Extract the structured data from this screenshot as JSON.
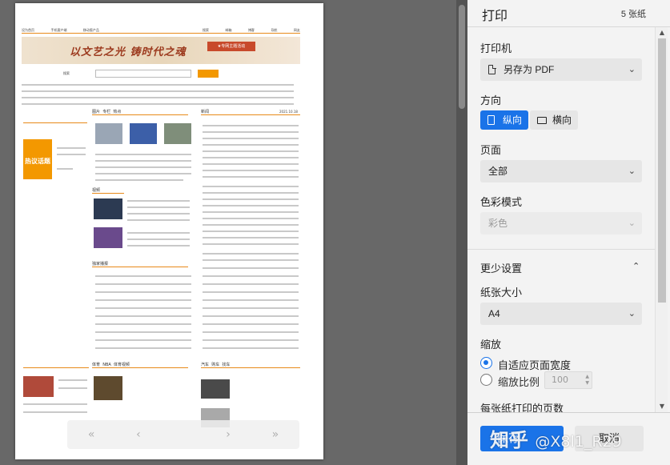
{
  "preview": {
    "banner_title": "以文艺之光 铸时代之魂",
    "banner_badge": "★专网主题活动",
    "search_label": "搜索",
    "tabs": [
      "图片",
      "专栏",
      "热点"
    ],
    "section_news": "新闻",
    "section_video": [
      "视频",
      "体育"
    ],
    "section_hot": "独家播报",
    "section_sports": [
      "体育",
      "NBA",
      "体育视频"
    ],
    "section_car": [
      "汽车",
      "购车",
      "找车"
    ],
    "promo_text": "热议话题",
    "date_text": "2021.10.18",
    "nav_prev": "«",
    "nav_back": "‹",
    "nav_next": "›",
    "nav_last": "»"
  },
  "dialog": {
    "title": "打印",
    "count": "5 张纸",
    "printer_label": "打印机",
    "printer_value": "另存为 PDF",
    "orientation_label": "方向",
    "portrait": "纵向",
    "landscape": "横向",
    "pages_label": "页面",
    "pages_value": "全部",
    "color_label": "色彩模式",
    "color_value": "彩色",
    "more_settings": "更少设置",
    "paper_label": "纸张大小",
    "paper_value": "A4",
    "scale_label": "缩放",
    "scale_fit": "自适应页面宽度",
    "scale_custom": "缩放比例",
    "scale_value": "100",
    "pages_per_sheet": "每张纸打印的页数",
    "print_button": "保存",
    "cancel_button": "取消"
  },
  "watermark": {
    "brand": "知乎",
    "handle": "@X8l1_R29"
  },
  "colors": {
    "accent": "#1a73e8",
    "preview_bg": "#686868",
    "dialog_bg": "#f3f3f3",
    "site_orange": "#f39800"
  }
}
